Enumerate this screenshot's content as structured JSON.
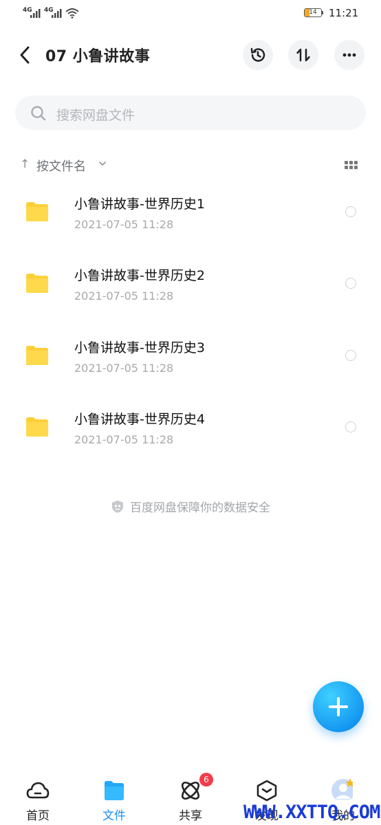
{
  "status_bar": {
    "signal_1": "4G",
    "signal_2": "4G",
    "battery": "14",
    "time": "11:21"
  },
  "header": {
    "title": "07 小鲁讲故事",
    "back_icon": "chevron-left-icon",
    "actions": [
      "history-icon",
      "transfer-icon",
      "more-icon"
    ]
  },
  "search": {
    "placeholder": "搜索网盘文件"
  },
  "sort": {
    "label": "按文件名",
    "view_icon": "grid-icon"
  },
  "files": [
    {
      "name": "小鲁讲故事-世界历史1",
      "date": "2021-07-05  11:28"
    },
    {
      "name": "小鲁讲故事-世界历史2",
      "date": "2021-07-05  11:28"
    },
    {
      "name": "小鲁讲故事-世界历史3",
      "date": "2021-07-05  11:28"
    },
    {
      "name": "小鲁讲故事-世界历史4",
      "date": "2021-07-05  11:28"
    }
  ],
  "security_note": "百度网盘保障你的数据安全",
  "nav": {
    "items": [
      {
        "label": "首页",
        "icon": "cloud-icon"
      },
      {
        "label": "文件",
        "icon": "folder-icon"
      },
      {
        "label": "共享",
        "icon": "share-orbit-icon"
      },
      {
        "label": "发现",
        "icon": "discover-box-icon"
      },
      {
        "label": "我的",
        "icon": "avatar-icon"
      }
    ],
    "share_badge": "6"
  },
  "colors": {
    "accent": "#1b8df2",
    "folder": "#ffcf3a",
    "badge": "#f23d4a"
  },
  "watermark": "WWW.XXTTQ.COM"
}
